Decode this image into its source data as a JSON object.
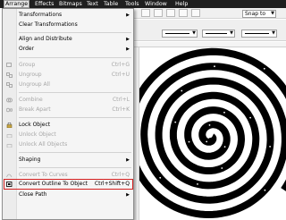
{
  "menubar": {
    "items": [
      {
        "label": "Arrange",
        "active": true
      },
      {
        "label": "Effects"
      },
      {
        "label": "Bitmaps"
      },
      {
        "label": "Text"
      },
      {
        "label": "Table"
      },
      {
        "label": "Tools"
      },
      {
        "label": "Window"
      },
      {
        "label": "Help"
      }
    ]
  },
  "toolbar": {
    "snap_label": "Snap to"
  },
  "menu": {
    "items": [
      {
        "label": "Transformations",
        "submenu": true,
        "disabled": false
      },
      {
        "label": "Clear Transformations",
        "disabled": false
      },
      {
        "label": "Align and Distribute",
        "submenu": true,
        "disabled": false
      },
      {
        "label": "Order",
        "submenu": true,
        "disabled": false
      },
      {
        "label": "Group",
        "shortcut": "Ctrl+G",
        "disabled": true
      },
      {
        "label": "Ungroup",
        "shortcut": "Ctrl+U",
        "disabled": true
      },
      {
        "label": "Ungroup All",
        "disabled": true
      },
      {
        "label": "Combine",
        "shortcut": "Ctrl+L",
        "disabled": true
      },
      {
        "label": "Break Apart",
        "shortcut": "Ctrl+K",
        "disabled": true
      },
      {
        "label": "Lock Object",
        "disabled": false
      },
      {
        "label": "Unlock Object",
        "disabled": true
      },
      {
        "label": "Unlock All Objects",
        "disabled": true
      },
      {
        "label": "Shaping",
        "submenu": true,
        "disabled": false
      },
      {
        "label": "Convert To Curves",
        "shortcut": "Ctrl+Q",
        "disabled": true
      },
      {
        "label": "Convert Outline To Object",
        "shortcut": "Ctrl+Shift+Q",
        "disabled": false,
        "highlighted": true
      },
      {
        "label": "Close Path",
        "submenu": true,
        "disabled": false
      }
    ]
  },
  "colors": {
    "menubar_bg": "#1f1f1f",
    "highlight_border": "#d42020",
    "spiral": "#000000"
  }
}
